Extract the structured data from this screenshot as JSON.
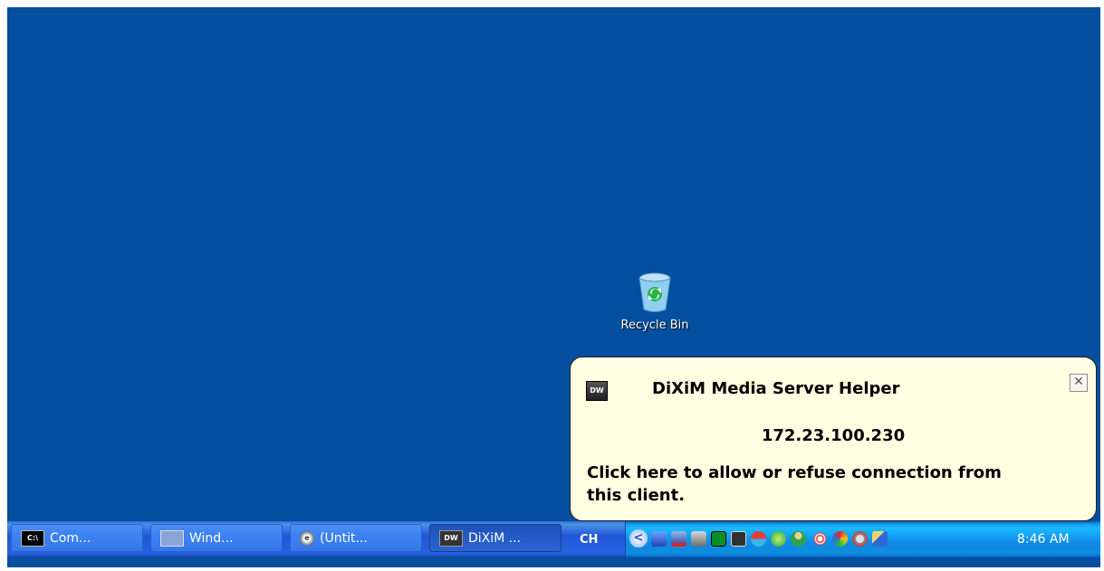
{
  "desktop": {
    "icons": [
      {
        "label": "Recycle Bin",
        "icon": "recycle-bin-icon"
      }
    ]
  },
  "balloon": {
    "logo": "DW",
    "title": "DiXiM Media Server Helper",
    "ip": "172.23.100.230",
    "message": "Click here to allow or refuse connection from this client.",
    "close_icon": "close-icon"
  },
  "taskbar": {
    "buttons": [
      {
        "label": "Com...",
        "icon": "command-prompt-icon",
        "icon_text": "C:\\"
      },
      {
        "label": "Wind...",
        "icon": "windows-explorer-icon",
        "icon_text": ""
      },
      {
        "label": "(Untit...",
        "icon": "internet-explorer-icon",
        "icon_text": "e"
      },
      {
        "label": "DiXiM ...",
        "icon": "dixim-icon",
        "icon_text": "DW"
      }
    ],
    "language": "CH",
    "tray_chevron": "<",
    "tray_icons": [
      "network-connections-icon",
      "network-disconnected-icon",
      "monitor-icon",
      "green-status-icon",
      "dixim-tray-icon",
      "up-down-arrows-icon",
      "security-shield-icon",
      "user-icon",
      "wireless-icon",
      "color-wheel-icon",
      "speaker-icon",
      "broom-icon"
    ],
    "clock": "8:46 AM"
  },
  "colors": {
    "desktop": "#044f9f",
    "taskbar": "#2663e0",
    "tray": "#13a0e9",
    "balloon": "#ffffe1"
  }
}
